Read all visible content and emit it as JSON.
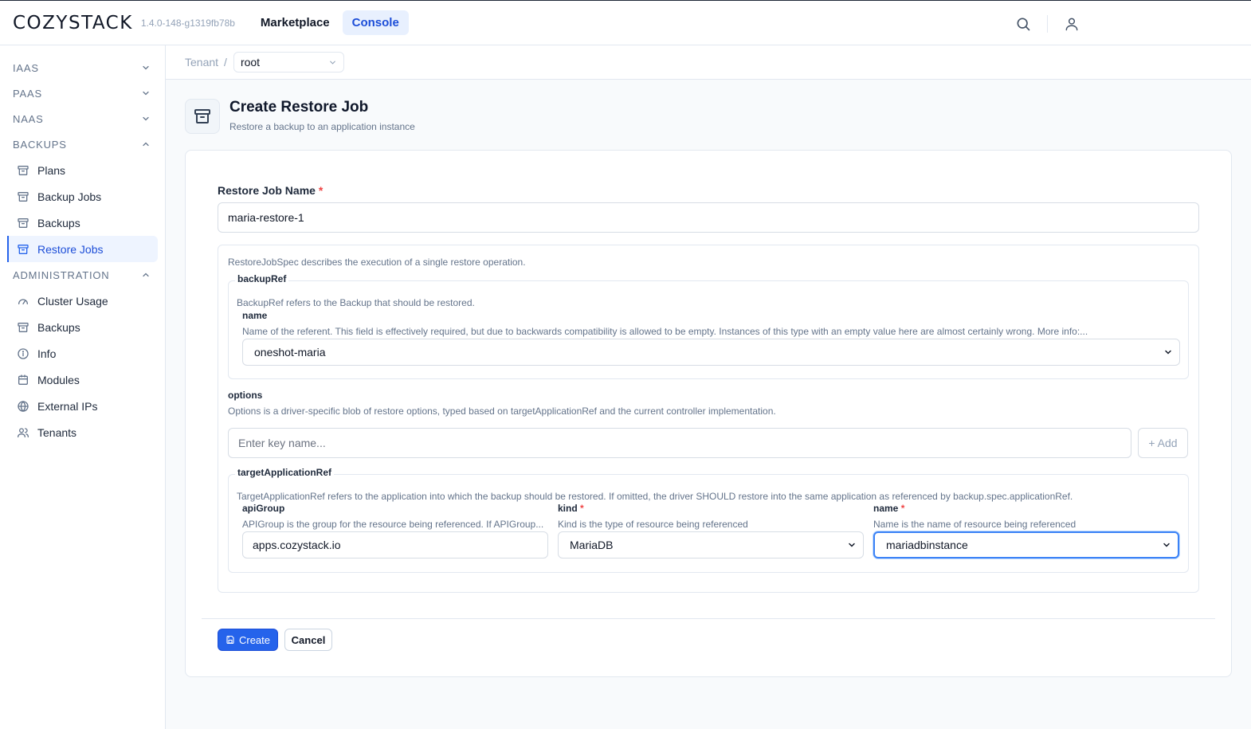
{
  "header": {
    "logo": "COZYSTACK",
    "version": "1.4.0-148-g1319fb78b",
    "nav": [
      {
        "label": "Marketplace",
        "active": false
      },
      {
        "label": "Console",
        "active": true
      }
    ],
    "search_icon": "search-icon",
    "user_icon": "user-icon"
  },
  "sidebar": {
    "sections": [
      {
        "label": "IAAS",
        "expanded": false,
        "items": []
      },
      {
        "label": "PAAS",
        "expanded": false,
        "items": []
      },
      {
        "label": "NAAS",
        "expanded": false,
        "items": []
      },
      {
        "label": "BACKUPS",
        "expanded": true,
        "items": [
          {
            "label": "Plans",
            "icon": "archive-icon",
            "active": false
          },
          {
            "label": "Backup Jobs",
            "icon": "archive-icon",
            "active": false
          },
          {
            "label": "Backups",
            "icon": "archive-icon",
            "active": false
          },
          {
            "label": "Restore Jobs",
            "icon": "archive-icon",
            "active": true
          }
        ]
      },
      {
        "label": "ADMINISTRATION",
        "expanded": true,
        "items": [
          {
            "label": "Cluster Usage",
            "icon": "gauge-icon",
            "active": false
          },
          {
            "label": "Backups",
            "icon": "archive-icon",
            "active": false
          },
          {
            "label": "Info",
            "icon": "info-icon",
            "active": false
          },
          {
            "label": "Modules",
            "icon": "calendar-icon",
            "active": false
          },
          {
            "label": "External IPs",
            "icon": "globe-icon",
            "active": false
          },
          {
            "label": "Tenants",
            "icon": "users-icon",
            "active": false
          }
        ]
      }
    ]
  },
  "breadcrumb": {
    "tenant_label": "Tenant",
    "separator": "/",
    "namespace": "root"
  },
  "page": {
    "title": "Create Restore Job",
    "subtitle": "Restore a backup to an application instance"
  },
  "form": {
    "name_label": "Restore Job Name",
    "required_mark": "*",
    "name_value": "maria-restore-1",
    "spec_desc": "RestoreJobSpec describes the execution of a single restore operation.",
    "backupRef": {
      "legend": "backupRef",
      "desc": "BackupRef refers to the Backup that should be restored.",
      "name_label": "name",
      "name_desc": "Name of the referent. This field is effectively required, but due to backwards compatibility is allowed to be empty. Instances of this type with an empty value here are almost certainly wrong. More info:...",
      "name_value": "oneshot-maria"
    },
    "options": {
      "label": "options",
      "desc": "Options is a driver-specific blob of restore options, typed based on targetApplicationRef and the current controller implementation.",
      "key_placeholder": "Enter key name...",
      "add_label": "+ Add"
    },
    "target": {
      "legend": "targetApplicationRef",
      "desc": "TargetApplicationRef refers to the application into which the backup should be restored. If omitted, the driver SHOULD restore into the same application as referenced by backup.spec.applicationRef.",
      "apiGroup_label": "apiGroup",
      "apiGroup_desc": "APIGroup is the group for the resource being referenced. If APIGroup...",
      "apiGroup_value": "apps.cozystack.io",
      "kind_label": "kind",
      "kind_desc": "Kind is the type of resource being referenced",
      "kind_value": "MariaDB",
      "name_label": "name",
      "name_desc": "Name is the name of resource being referenced",
      "name_value": "mariadbinstance"
    },
    "create_label": "Create",
    "cancel_label": "Cancel"
  },
  "colors": {
    "accent": "#2563eb",
    "required": "#ef4444",
    "active_bg": "#eef4ff"
  }
}
